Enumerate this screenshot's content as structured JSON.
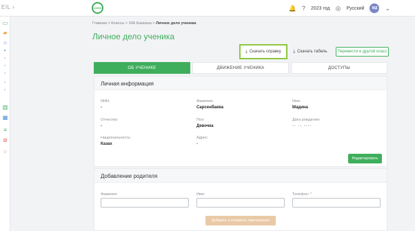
{
  "app": {
    "brand": "EIL",
    "logo_text": "LOGO"
  },
  "topbar": {
    "year": "2023 год",
    "language": "Русский",
    "avatar": "МД"
  },
  "breadcrumbs": {
    "home": "Главная",
    "classes": "Классы",
    "klass": "10А Казахша",
    "current": "Личное дело ученика",
    "sep": ">"
  },
  "page": {
    "title": "Личное дело ученика"
  },
  "actions": {
    "download_certificate": "Скачать справку",
    "download_timesheet": "Скачать табель",
    "transfer": "Перевести в другой класс"
  },
  "tabs": [
    {
      "label": "ОБ УЧЕНИКЕ",
      "active": true
    },
    {
      "label": "ДВИЖЕНИЕ УЧЕНИКА",
      "active": false
    },
    {
      "label": "ДОСТУПЫ",
      "active": false
    }
  ],
  "personal": {
    "title": "Личная информация",
    "iin_label": "ИИН:",
    "iin_value": "-",
    "surname_label": "Фамилия:",
    "surname_value": "Сарсенбаева",
    "name_label": "Имя:",
    "name_value": "Мадина",
    "patronymic_label": "Отчество:",
    "patronymic_value": "-",
    "gender_label": "Пол:",
    "gender_value": "Девочка",
    "birth_label": "Дата рождения:",
    "birth_value": "•• •• ••••",
    "nationality_label": "Национальность:",
    "nationality_value": "Казах",
    "address_label": "Адрес:",
    "address_value": "-",
    "edit_button": "Редактировать"
  },
  "parent": {
    "title": "Добавление родителя",
    "surname_label": "Фамилия:",
    "name_label": "Имя:",
    "phone_label": "Телефон: *",
    "invite_button": "Добавить и отправить приглашение"
  },
  "colors": {
    "accent": "#3fae5c",
    "highlight": "#8cc63f",
    "disabled_button": "#eac9a6"
  }
}
